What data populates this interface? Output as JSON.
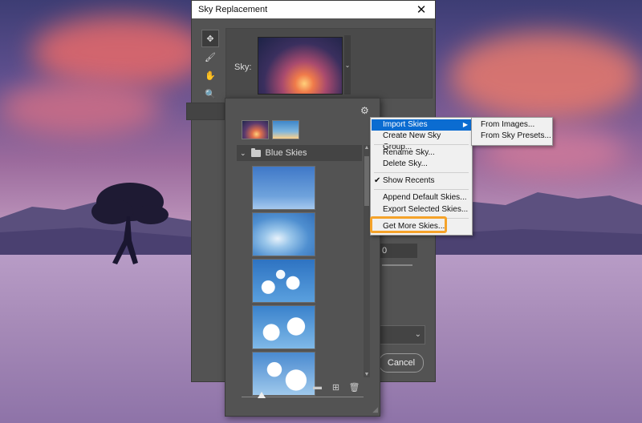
{
  "dialog": {
    "title": "Sky Replacement",
    "close_glyph": "✕",
    "sky_label": "Sky:",
    "value_partial": "0",
    "cancel_label": "Cancel"
  },
  "tools": [
    {
      "name": "move-icon",
      "glyph": "✥"
    },
    {
      "name": "sky-brush-icon",
      "glyph": "🖌"
    },
    {
      "name": "hand-icon",
      "glyph": "✋"
    },
    {
      "name": "zoom-icon",
      "glyph": "🔍"
    }
  ],
  "panel": {
    "group_name": "Blue Skies",
    "gear_glyph": "⚙",
    "thumb_count": 5,
    "slider_position": 0.13
  },
  "menu": {
    "items": [
      {
        "label": "Import Skies",
        "highlighted": true,
        "submenu": true
      },
      {
        "label": "Create New Sky Group..."
      },
      {
        "label": "Rename Sky..."
      },
      {
        "label": "Delete Sky..."
      },
      {
        "label": "Show Recents",
        "checked": true
      },
      {
        "label": "Append Default Skies..."
      },
      {
        "label": "Export Selected Skies..."
      },
      {
        "label": "Get More Skies...",
        "outlined": true
      }
    ],
    "submenu_items": [
      {
        "label": "From Images..."
      },
      {
        "label": "From Sky Presets..."
      }
    ]
  },
  "colors": {
    "menu_highlight": "#0b6cd1",
    "callout_outline": "#f5a32a",
    "dialog_bg": "#535353"
  }
}
